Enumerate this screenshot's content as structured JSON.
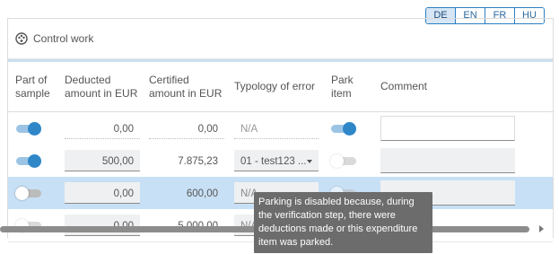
{
  "languages": [
    "DE",
    "EN",
    "FR",
    "HU"
  ],
  "active_language": "DE",
  "panel": {
    "title": "Control work",
    "icon": "palette-icon"
  },
  "columns": {
    "part_of_sample": "Part of sample",
    "deducted": "Deducted amount in EUR",
    "certified": "Certified amount in EUR",
    "typology": "Typology of error",
    "park": "Park item",
    "comment": "Comment"
  },
  "rows": [
    {
      "part_of_sample": true,
      "deducted": "0,00",
      "certified": "0,00",
      "typology": "N/A",
      "park": true,
      "comment": ""
    },
    {
      "part_of_sample": true,
      "deducted": "500,00",
      "certified": "7.875,23",
      "typology": "01 - test123 ...",
      "park": false,
      "comment": ""
    },
    {
      "part_of_sample": false,
      "deducted": "0,00",
      "certified": "600,00",
      "typology": "N/A",
      "park": false,
      "comment": "",
      "selected": true
    },
    {
      "part_of_sample": false,
      "deducted": "0,00",
      "certified": "5.000,00",
      "typology": "N/A",
      "park": false,
      "comment": ""
    }
  ],
  "tooltip": "Parking is disabled because, during the verification step, there were deductions made or this expenditure item was parked.",
  "colors": {
    "accent": "#2f87c8",
    "selected_row": "#c8e0f5",
    "tooltip_bg": "#6c6c6c"
  }
}
